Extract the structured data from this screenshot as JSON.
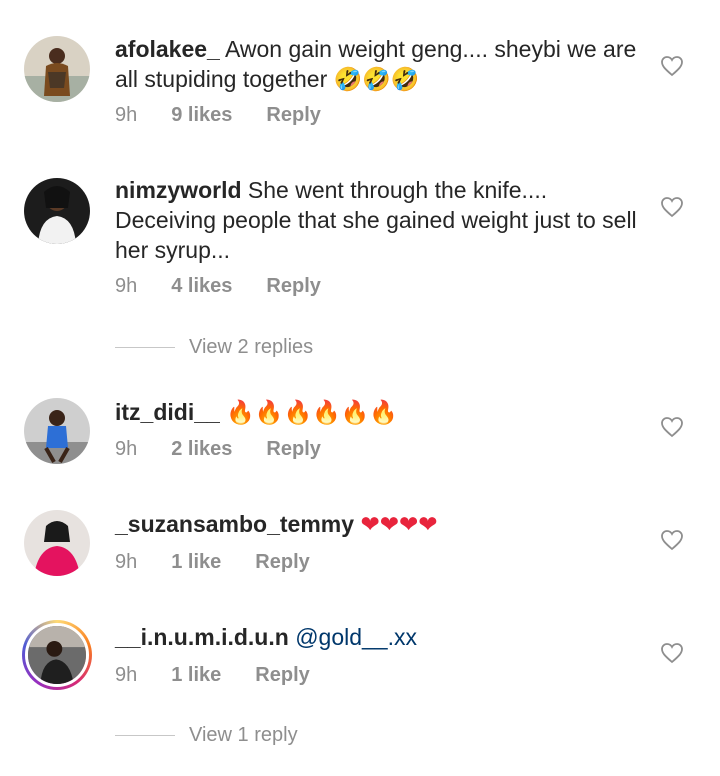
{
  "comments": [
    {
      "username": "afolakee_",
      "text": "Awon gain weight geng.... sheybi we are all stupiding together",
      "emoji": "🤣🤣🤣",
      "time": "9h",
      "likes": "9 likes",
      "reply": "Reply"
    },
    {
      "username": "nimzyworld",
      "text": "She went through the knife.... Deceiving people that she gained weight just to sell her syrup...",
      "emoji": "",
      "time": "9h",
      "likes": "4 likes",
      "reply": "Reply",
      "view_replies": "View 2 replies"
    },
    {
      "username": "itz_didi__",
      "text": "",
      "emoji": "🔥🔥🔥🔥🔥🔥",
      "time": "9h",
      "likes": "2 likes",
      "reply": "Reply"
    },
    {
      "username": "_suzansambo_temmy",
      "text": "",
      "emoji": "❤❤❤❤",
      "time": "9h",
      "likes": "1 like",
      "reply": "Reply"
    },
    {
      "username": "__i.n.u.m.i.d.u.n",
      "text": "",
      "mention": "@gold__.xx",
      "time": "9h",
      "likes": "1 like",
      "reply": "Reply",
      "view_replies": "View 1 reply"
    }
  ],
  "icons": {
    "like": "heart-outline-icon",
    "fire": "fire-emoji",
    "heart": "red-heart-emoji",
    "laugh": "rofl-emoji"
  }
}
